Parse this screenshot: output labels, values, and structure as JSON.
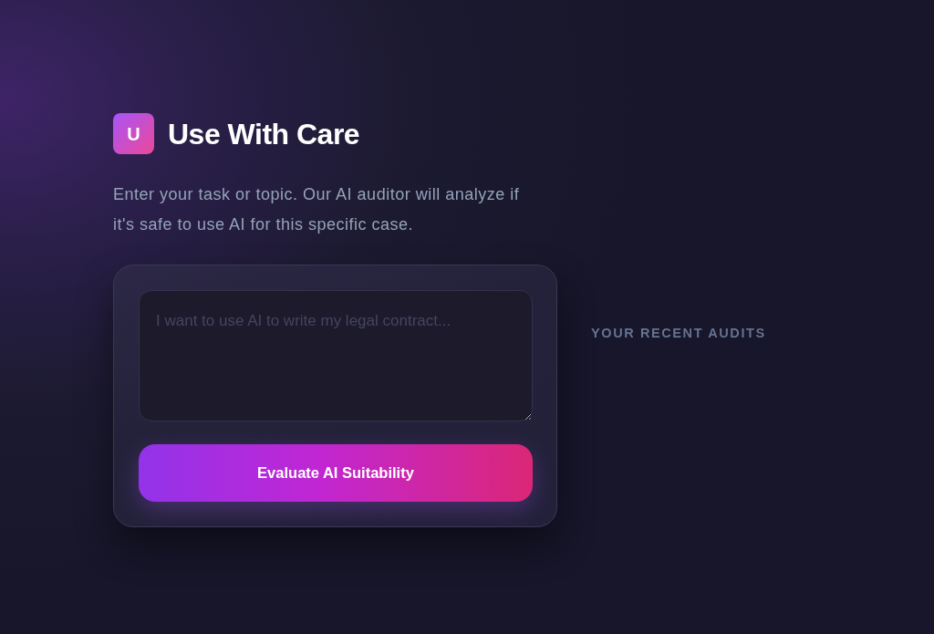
{
  "header": {
    "logo_letter": "U",
    "title": "Use With Care"
  },
  "description": "Enter your task or topic. Our AI auditor will analyze if it's safe to use AI for this specific case.",
  "audit_form": {
    "task_input": {
      "placeholder": "I want to use AI to write my legal contract..."
    },
    "submit_button": "Evaluate AI Suitability"
  },
  "recent_audits": {
    "heading": "YOUR RECENT AUDITS"
  }
}
